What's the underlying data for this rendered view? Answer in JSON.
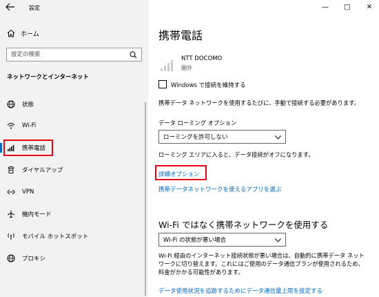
{
  "window": {
    "title": "設定",
    "controls": {
      "minimize": "—",
      "maximize": "□",
      "close": "✕"
    }
  },
  "sidebar": {
    "home_label": "ホーム",
    "search_placeholder": "設定の検索",
    "section_title": "ネットワークとインターネット",
    "items": [
      {
        "label": "状態",
        "icon": "globe-icon"
      },
      {
        "label": "Wi-Fi",
        "icon": "wifi-icon"
      },
      {
        "label": "携帯電話",
        "icon": "cellular-icon",
        "active": true
      },
      {
        "label": "ダイヤルアップ",
        "icon": "phone-icon"
      },
      {
        "label": "VPN",
        "icon": "vpn-icon"
      },
      {
        "label": "機内モード",
        "icon": "airplane-icon"
      },
      {
        "label": "モバイル ホットスポット",
        "icon": "hotspot-icon"
      },
      {
        "label": "プロキシ",
        "icon": "globe-icon"
      }
    ]
  },
  "main": {
    "title": "携帯電話",
    "carrier": {
      "name": "NTT DOCOMO",
      "status": "圏外"
    },
    "keep_connected_label": "Windows で接続を維持する",
    "data_description": "携帯データ ネットワークを使用するたびに、手動で接続する必要があります。",
    "roaming_label": "データ ローミング オプション",
    "roaming_value": "ローミングを許可しない",
    "roaming_note": "ローミング エリアに入ると、データ接続がオフになります。",
    "advanced_link": "詳細オプション",
    "apps_link": "携帯データネットワークを使えるアプリを選ぶ",
    "wifi_section_title": "Wi-Fi ではなく携帯ネットワークを使用する",
    "wifi_option_value": "Wi-Fi の状態が悪い場合",
    "wifi_paragraph": "Wi-Fi 経由のインターネット接続状態が悪い場合は、自動的に携帯データ ネットワークに切り替えます。これにはご使用のデータ通信プランが使用されるため、料金がかかる可能性があります。",
    "limit_link": "データ使用状況を追跡するためにデータ通信量上限を設定する"
  },
  "colors": {
    "accent": "#0067c0",
    "highlight": "#e60012",
    "sidebar_bg": "#f2f2f2"
  }
}
